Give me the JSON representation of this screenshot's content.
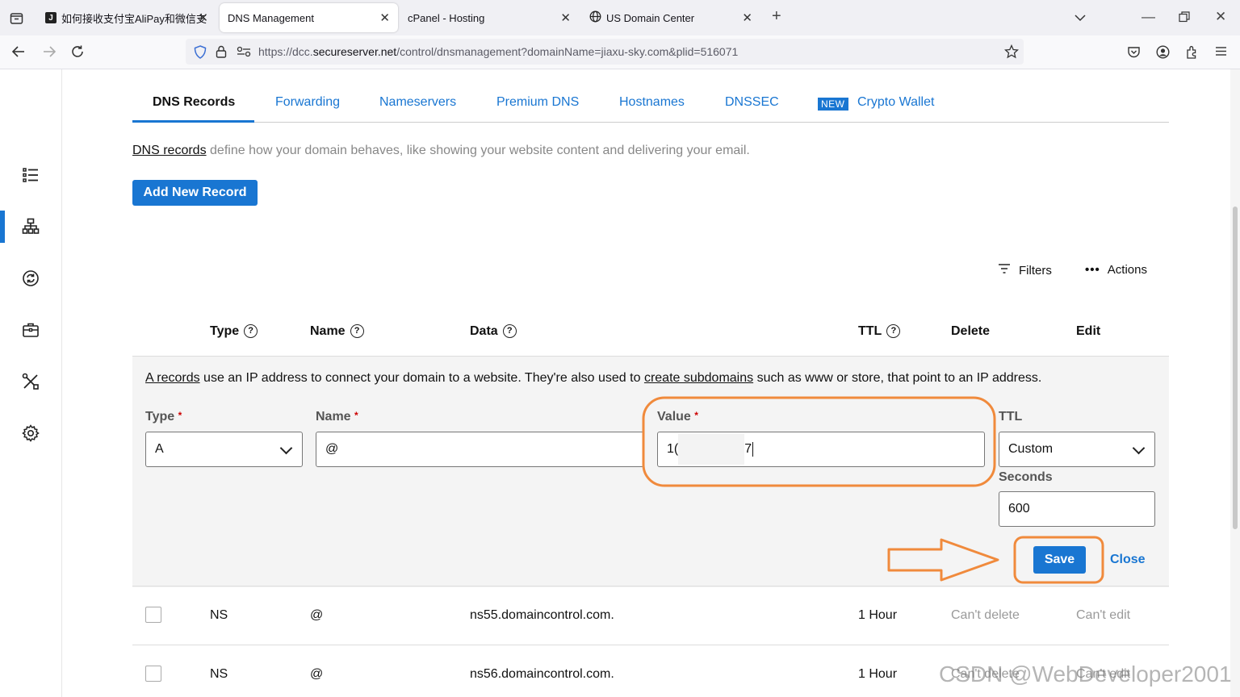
{
  "browser": {
    "tabs": [
      {
        "title": "如何接收支付宝AliPay和微信支"
      },
      {
        "title": "DNS Management"
      },
      {
        "title": "cPanel - Hosting"
      },
      {
        "title": "US Domain Center"
      }
    ],
    "url_prefix": "https://dcc.",
    "url_domain": "secureserver.net",
    "url_rest": "/control/dnsmanagement?domainName=jiaxu-sky.com&plid=516071"
  },
  "page_tabs": [
    "DNS Records",
    "Forwarding",
    "Nameservers",
    "Premium DNS",
    "Hostnames",
    "DNSSEC",
    "Crypto Wallet"
  ],
  "new_badge": "NEW",
  "intro": {
    "link": "DNS records",
    "rest": " define how your domain behaves, like showing your website content and delivering your email."
  },
  "add_button": "Add New Record",
  "toolbar": {
    "filters": "Filters",
    "actions": "Actions"
  },
  "table_headers": {
    "type": "Type",
    "name": "Name",
    "data": "Data",
    "ttl": "TTL",
    "delete": "Delete",
    "edit": "Edit"
  },
  "a_info": {
    "link1": "A records",
    "text1": " use an IP address to connect your domain to a website. They're also used to ",
    "link2": "create subdomains",
    "text2": " such as www or store, that point to an IP address."
  },
  "form": {
    "type_label": "Type",
    "type_value": "A",
    "name_label": "Name",
    "name_value": "@",
    "value_label": "Value",
    "value_start": "1(",
    "value_end": "7",
    "ttl_label": "TTL",
    "ttl_value": "Custom",
    "seconds_label": "Seconds",
    "seconds_value": "600",
    "req_mark": "*",
    "save": "Save",
    "close": "Close"
  },
  "records": [
    {
      "type": "NS",
      "name": "@",
      "data": "ns55.domaincontrol.com.",
      "ttl": "1 Hour",
      "delete": "Can't delete",
      "edit": "Can't edit"
    },
    {
      "type": "NS",
      "name": "@",
      "data": "ns56.domaincontrol.com.",
      "ttl": "1 Hour",
      "delete": "Can't delete",
      "edit": "Can't edit"
    }
  ],
  "watermark": "CSDN @WebDeveloper2001",
  "colors": {
    "accent": "#1976d2",
    "annotation": "#f08a3c"
  }
}
